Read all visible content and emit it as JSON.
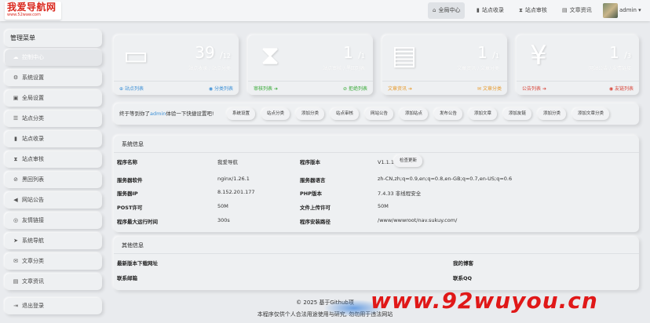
{
  "logo": {
    "main": "我爱导航网",
    "sub": "www.52waw.com"
  },
  "nav": [
    {
      "icon": "home-icon",
      "glyph": "⌂",
      "label": "全局中心"
    },
    {
      "icon": "book-icon",
      "glyph": "▮",
      "label": "站点收录"
    },
    {
      "icon": "hourglass-icon",
      "glyph": "⧗",
      "label": "站点审核"
    },
    {
      "icon": "news-icon",
      "glyph": "▤",
      "label": "文章资讯"
    }
  ],
  "user": {
    "name": "admin",
    "caret": "▾"
  },
  "sidebar": {
    "title": "管理菜单",
    "items": [
      {
        "glyph": "☁",
        "label": "控制中心"
      },
      {
        "glyph": "⚙",
        "label": "系统设置"
      },
      {
        "glyph": "▣",
        "label": "全局设置"
      },
      {
        "glyph": "☰",
        "label": "站点分类"
      },
      {
        "glyph": "▮",
        "label": "站点收录"
      },
      {
        "glyph": "⧗",
        "label": "站点审核"
      },
      {
        "glyph": "⊘",
        "label": "黑回列表"
      },
      {
        "glyph": "◀",
        "label": "网站公告"
      },
      {
        "glyph": "◎",
        "label": "友情链接"
      },
      {
        "glyph": "➤",
        "label": "系统导航"
      },
      {
        "glyph": "✉",
        "label": "文章分类"
      },
      {
        "glyph": "▤",
        "label": "文章资讯"
      }
    ],
    "logout": {
      "glyph": "⇥",
      "label": "退出登录"
    }
  },
  "cards": [
    {
      "glyph": "▭",
      "num": "39",
      "den": "12",
      "sub": "站点收录 / 站点分类",
      "left": {
        "glyph": "⊕",
        "label": "站点列表",
        "color": "#3b8fd6"
      },
      "right": {
        "glyph": "◉",
        "label": "分类列表",
        "color": "#3b8fd6"
      }
    },
    {
      "glyph": "⧗",
      "num": "1",
      "den": "1",
      "sub": "站点审核 / 黑回列表",
      "left": {
        "glyph": "➔",
        "label": "审核列表",
        "color": "#35a935"
      },
      "right": {
        "glyph": "⊘",
        "label": "拒绝列表",
        "color": "#35a935"
      }
    },
    {
      "glyph": "▤",
      "num": "1",
      "den": "1",
      "sub": "文章资讯 / 文章分类",
      "left": {
        "glyph": "➔",
        "label": "文章资讯",
        "color": "#e79a2c"
      },
      "right": {
        "glyph": "✉",
        "label": "文章分类",
        "color": "#e79a2c"
      }
    },
    {
      "glyph": "¥",
      "num": "1",
      "den": "3",
      "sub": "网站公告 / 友情链接",
      "left": {
        "glyph": "➔",
        "label": "公告列表",
        "color": "#d9463a"
      },
      "right": {
        "glyph": "◉",
        "label": "友链列表",
        "color": "#d9463a"
      }
    }
  ],
  "welcome": {
    "pre": "终于等到你了",
    "user": "admin",
    "post": "体验一下快捷设置吧!"
  },
  "quick": [
    "系统设置",
    "站点分类",
    "添加分类",
    "站点审核",
    "网站公告",
    "添加站点",
    "发布公告",
    "添加文章",
    "添加友链",
    "添加分类",
    "添加文章分类"
  ],
  "sysinfo": {
    "title": "系统信息",
    "rows": [
      {
        "k1": "程序名称",
        "v1": "我爱导航",
        "k2": "程序版本",
        "v2": "V1.1.1"
      },
      {
        "k1": "服务器软件",
        "v1": "nginx/1.26.1",
        "k2": "服务器语言",
        "v2": "zh-CN,zh;q=0.9,en;q=0.8,en-GB;q=0.7,en-US;q=0.6"
      },
      {
        "k1": "服务器IP",
        "v1": "8.152.201.177",
        "k2": "PHP版本",
        "v2": "7.4.33 非线程安全"
      },
      {
        "k1": "POST许可",
        "v1": "50M",
        "k2": "文件上传许可",
        "v2": "50M"
      },
      {
        "k1": "程序最大运行时间",
        "v1": "300s",
        "k2": "程序安装路径",
        "v2": "/www/wwwroot/nav.sukuy.com/"
      }
    ],
    "check_update": "检查更新"
  },
  "other": {
    "title": "其他信息",
    "rows": [
      {
        "k1": "最新版本下载网址",
        "k2": "我的博客"
      },
      {
        "k1": "联系邮箱",
        "k2": "联系QQ"
      }
    ]
  },
  "footer": {
    "line1": "© 2025 基于Github项",
    "line2": "本程序仅供个人合法用途使用与研究, 勿勿用于违法网站"
  },
  "watermark": "www.92wuyou.cn"
}
